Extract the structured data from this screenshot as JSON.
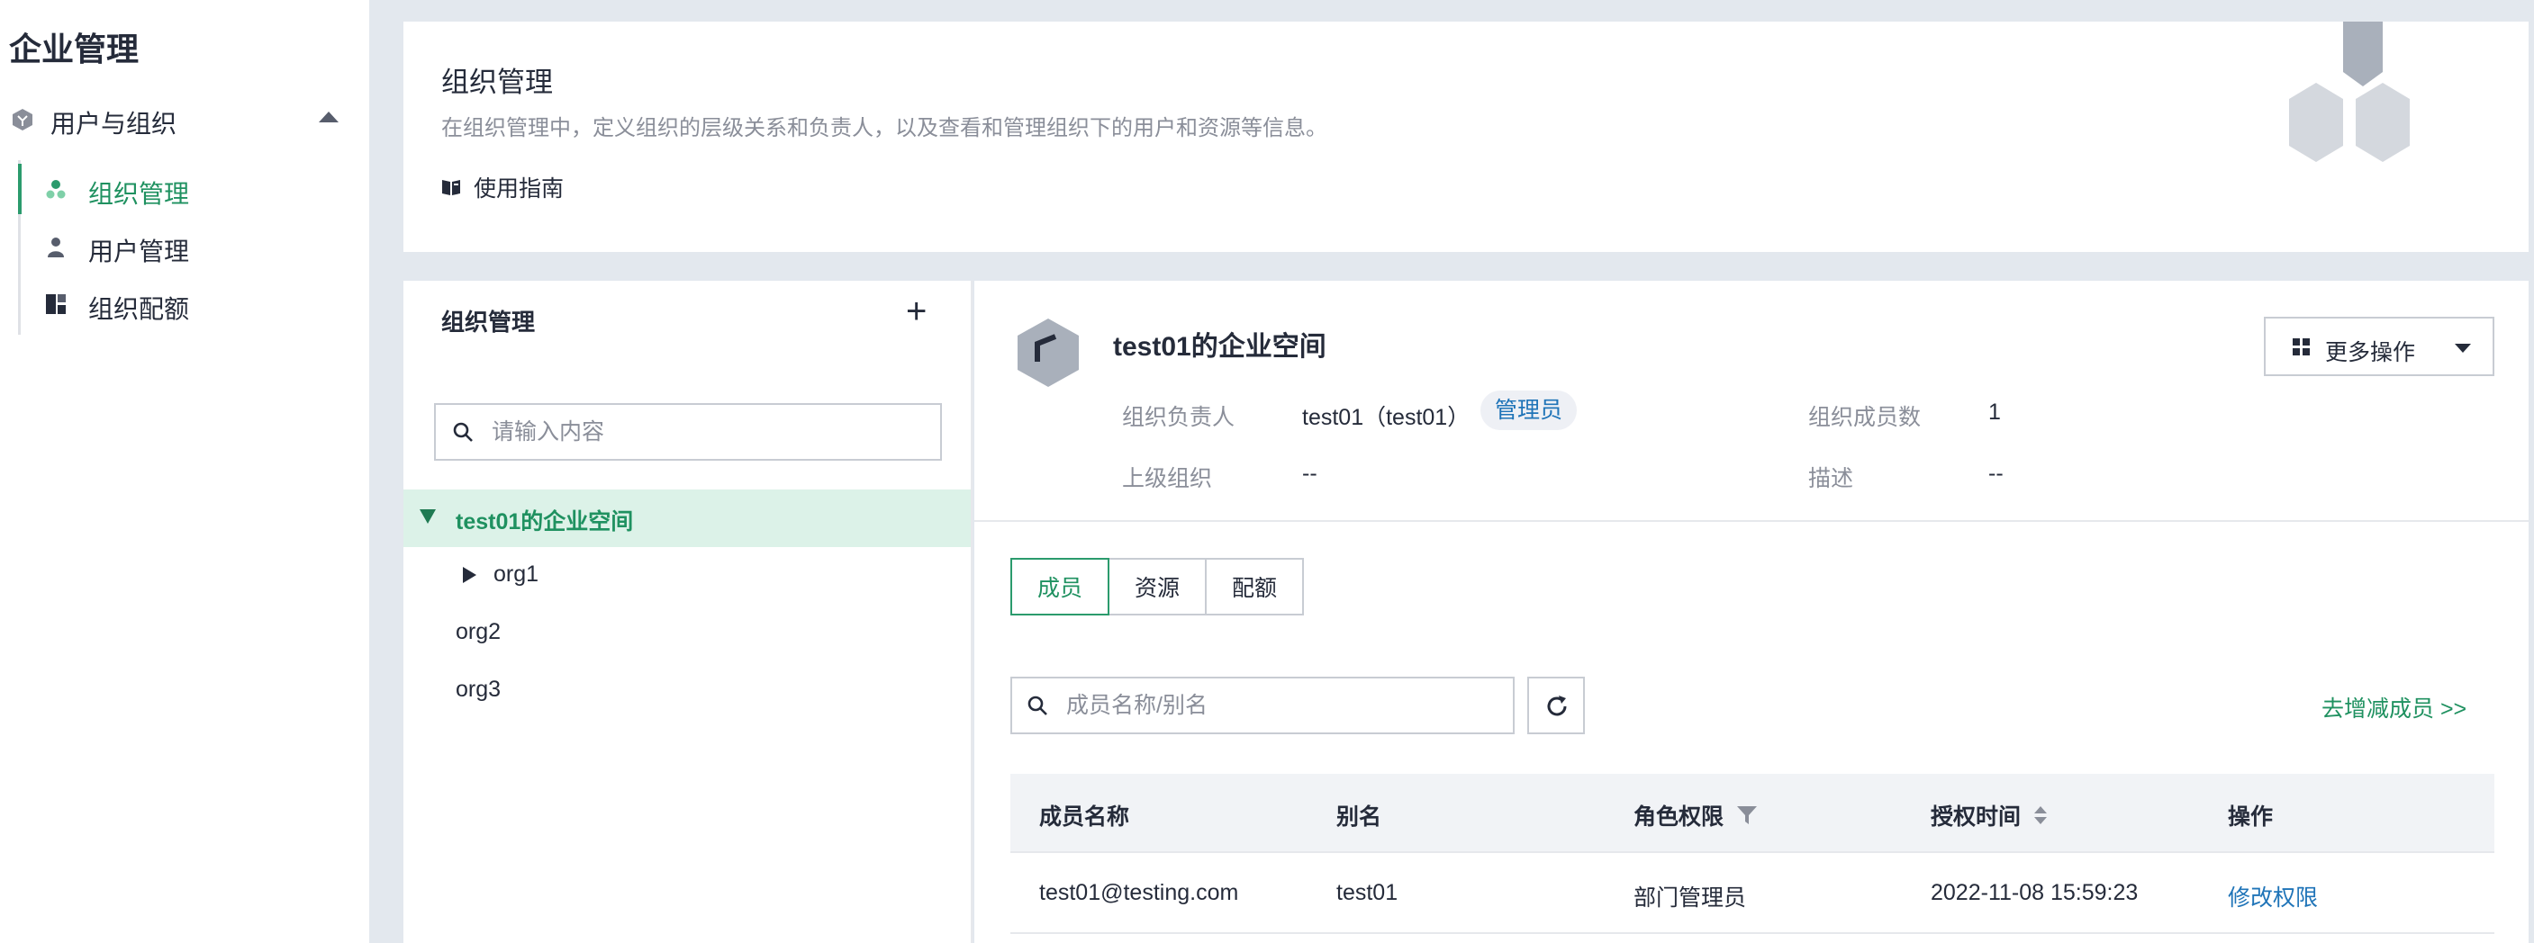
{
  "sidebar": {
    "title": "企业管理",
    "group": {
      "label": "用户与组织",
      "icon": "org-cube-icon"
    },
    "items": [
      {
        "label": "组织管理",
        "icon": "org-tree-icon",
        "active": true
      },
      {
        "label": "用户管理",
        "icon": "user-icon",
        "active": false
      },
      {
        "label": "组织配额",
        "icon": "quota-icon",
        "active": false
      }
    ]
  },
  "header": {
    "title": "组织管理",
    "description": "在组织管理中，定义组织的层级关系和负责人，以及查看和管理组织下的用户和资源等信息。",
    "guide_label": "使用指南"
  },
  "tree": {
    "title": "组织管理",
    "add_label": "+",
    "search_placeholder": "请输入内容",
    "nodes": [
      {
        "label": "test01的企业空间",
        "expanded": true,
        "selected": true
      },
      {
        "label": "org1",
        "expanded": false,
        "selected": false
      },
      {
        "label": "org2",
        "selected": false
      },
      {
        "label": "org3",
        "selected": false
      }
    ]
  },
  "detail": {
    "org_name": "test01的企业空间",
    "more_actions_label": "更多操作",
    "owner_label": "组织负责人",
    "owner_value": "test01（test01）",
    "owner_role": "管理员",
    "member_count_label": "组织成员数",
    "member_count_value": "1",
    "parent_label": "上级组织",
    "parent_value": "--",
    "desc_label": "描述",
    "desc_value": "--",
    "tabs": [
      "成员",
      "资源",
      "配额"
    ],
    "active_tab": "成员",
    "member_search_placeholder": "成员名称/别名",
    "manage_members_link": "去增减成员 >>",
    "table": {
      "headers": [
        "成员名称",
        "别名",
        "角色权限",
        "授权时间",
        "操作"
      ],
      "rows": [
        [
          "test01@testing.com",
          "test01",
          "部门管理员",
          "2022-11-08 15:59:23",
          "修改权限"
        ]
      ]
    }
  },
  "colors": {
    "accent": "#1f9160",
    "link": "#1f74b8",
    "background": "#e3e8ee",
    "selected_bg": "#dcf2e8"
  }
}
